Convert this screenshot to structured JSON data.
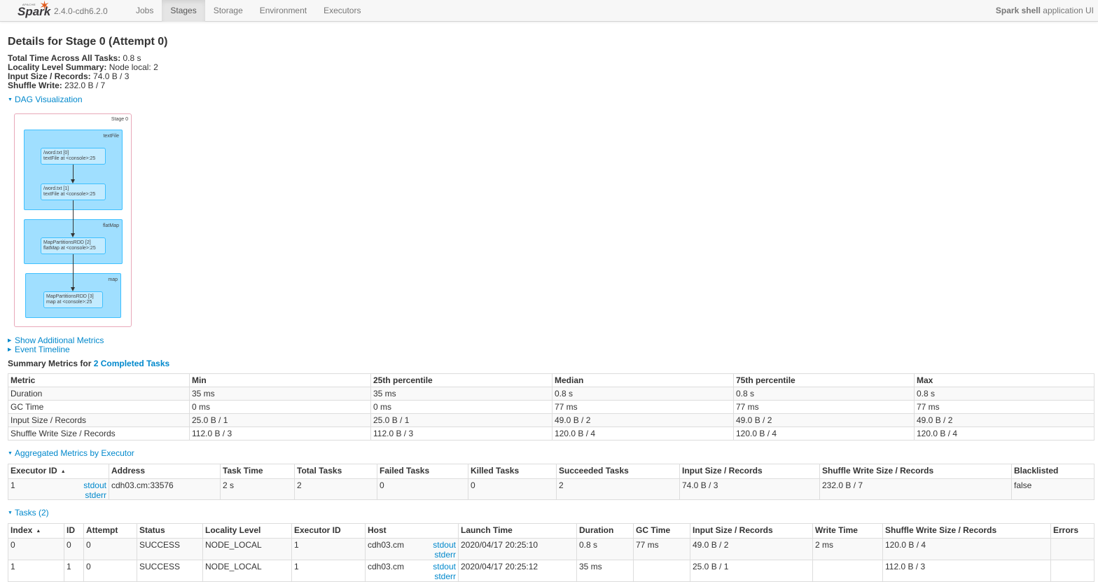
{
  "navbar": {
    "logo_small": "APACHE",
    "logo_word": "Spark",
    "version": "2.4.0-cdh6.2.0",
    "tabs": [
      {
        "label": "Jobs",
        "active": false
      },
      {
        "label": "Stages",
        "active": true
      },
      {
        "label": "Storage",
        "active": false
      },
      {
        "label": "Environment",
        "active": false
      },
      {
        "label": "Executors",
        "active": false
      }
    ],
    "app_name": "Spark shell",
    "app_suffix": " application UI"
  },
  "page": {
    "title": "Details for Stage 0 (Attempt 0)",
    "summary": [
      {
        "label": "Total Time Across All Tasks:",
        "value": " 0.8 s"
      },
      {
        "label": "Locality Level Summary:",
        "value": " Node local: 2"
      },
      {
        "label": "Input Size / Records:",
        "value": " 74.0 B / 3"
      },
      {
        "label": "Shuffle Write:",
        "value": " 232.0 B / 7"
      }
    ],
    "dag_toggle": "DAG Visualization",
    "additional_metrics": "Show Additional Metrics",
    "event_timeline": "Event Timeline",
    "summary_metrics_prefix": "Summary Metrics for ",
    "summary_metrics_link": "2 Completed Tasks",
    "aggregated_toggle": "Aggregated Metrics by Executor",
    "tasks_toggle": "Tasks (2)"
  },
  "dag": {
    "stage_label": "Stage 0",
    "clusters": [
      {
        "label": "textFile"
      },
      {
        "label": "flatMap"
      },
      {
        "label": "map"
      }
    ],
    "nodes": [
      {
        "line1": "/word.txt [0]",
        "line2": "textFile at <console>:25"
      },
      {
        "line1": "/word.txt [1]",
        "line2": "textFile at <console>:25"
      },
      {
        "line1": "MapPartitionsRDD [2]",
        "line2": "flatMap at <console>:25"
      },
      {
        "line1": "MapPartitionsRDD [3]",
        "line2": "map at <console>:25"
      }
    ]
  },
  "summary_table": {
    "headers": [
      "Metric",
      "Min",
      "25th percentile",
      "Median",
      "75th percentile",
      "Max"
    ],
    "rows": [
      [
        "Duration",
        "35 ms",
        "35 ms",
        "0.8 s",
        "0.8 s",
        "0.8 s"
      ],
      [
        "GC Time",
        "0 ms",
        "0 ms",
        "77 ms",
        "77 ms",
        "77 ms"
      ],
      [
        "Input Size / Records",
        "25.0 B / 1",
        "25.0 B / 1",
        "49.0 B / 2",
        "49.0 B / 2",
        "49.0 B / 2"
      ],
      [
        "Shuffle Write Size / Records",
        "112.0 B / 3",
        "112.0 B / 3",
        "120.0 B / 4",
        "120.0 B / 4",
        "120.0 B / 4"
      ]
    ]
  },
  "executor_table": {
    "headers": [
      "Executor ID",
      "Address",
      "Task Time",
      "Total Tasks",
      "Failed Tasks",
      "Killed Tasks",
      "Succeeded Tasks",
      "Input Size / Records",
      "Shuffle Write Size / Records",
      "Blacklisted"
    ],
    "sort_indicator": "▲",
    "row": {
      "executor_id": "1",
      "stdout": "stdout",
      "stderr": "stderr",
      "address": "cdh03.cm:33576",
      "task_time": "2 s",
      "total_tasks": "2",
      "failed_tasks": "0",
      "killed_tasks": "0",
      "succeeded_tasks": "2",
      "input": "74.0 B / 3",
      "shuffle_write": "232.0 B / 7",
      "blacklisted": "false"
    }
  },
  "tasks_table": {
    "headers": [
      "Index",
      "ID",
      "Attempt",
      "Status",
      "Locality Level",
      "Executor ID",
      "Host",
      "Launch Time",
      "Duration",
      "GC Time",
      "Input Size / Records",
      "Write Time",
      "Shuffle Write Size / Records",
      "Errors"
    ],
    "sort_indicator": "▲",
    "rows": [
      {
        "index": "0",
        "id": "0",
        "attempt": "0",
        "status": "SUCCESS",
        "locality": "NODE_LOCAL",
        "executor": "1",
        "host": "cdh03.cm",
        "stdout": "stdout",
        "stderr": "stderr",
        "launch": "2020/04/17 20:25:10",
        "duration": "0.8 s",
        "gc": "77 ms",
        "input": "49.0 B / 2",
        "write_time": "2 ms",
        "shuffle_write": "120.0 B / 4",
        "errors": ""
      },
      {
        "index": "1",
        "id": "1",
        "attempt": "0",
        "status": "SUCCESS",
        "locality": "NODE_LOCAL",
        "executor": "1",
        "host": "cdh03.cm",
        "stdout": "stdout",
        "stderr": "stderr",
        "launch": "2020/04/17 20:25:12",
        "duration": "35 ms",
        "gc": "",
        "input": "25.0 B / 1",
        "write_time": "",
        "shuffle_write": "112.0 B / 3",
        "errors": ""
      }
    ]
  },
  "colors": {
    "link": "#0088cc",
    "spark_orange": "#e25a1c",
    "dag_cluster": "#a0dfff",
    "dag_node": "#c3ebff",
    "dag_stage_border": "#e8a8b9"
  }
}
